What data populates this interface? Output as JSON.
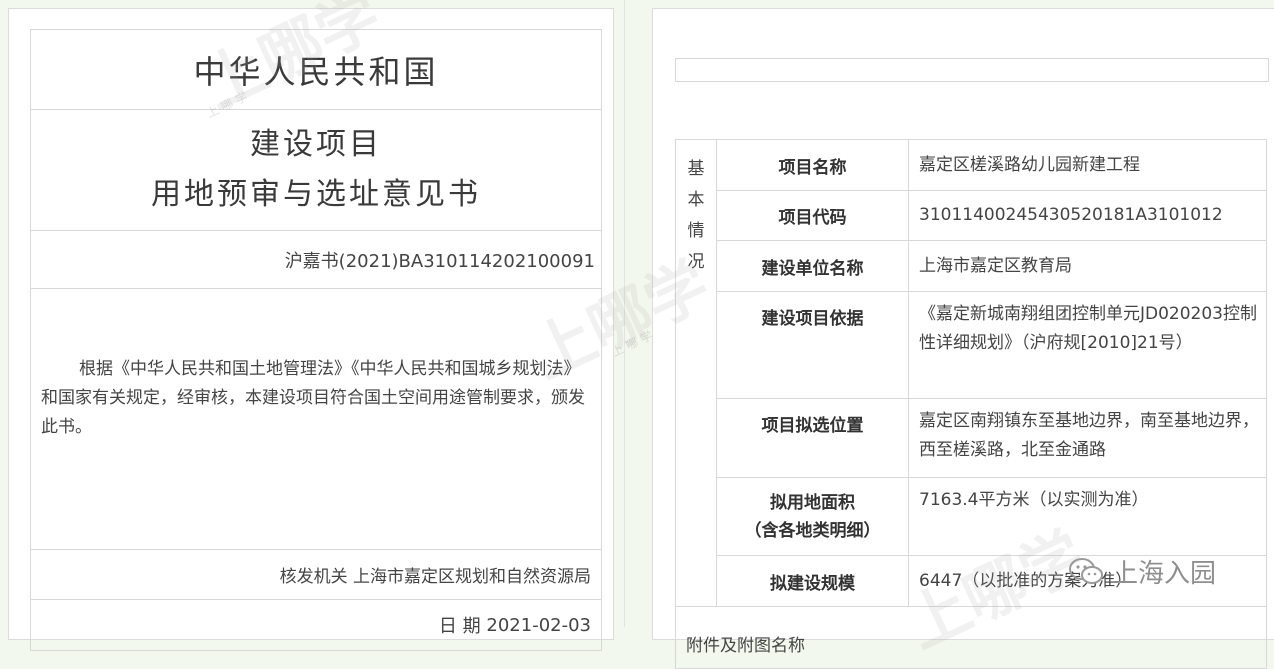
{
  "certificate": {
    "country_title": "中华人民共和国",
    "doc_title_line1": "建设项目",
    "doc_title_line2": "用地预审与选址意见书",
    "doc_number": "沪嘉书(2021)BA310114202100091",
    "body_text": "根据《中华人民共和国土地管理法》《中华人民共和国城乡规划法》和国家有关规定，经审核，本建设项目符合国土空间用途管制要求，颁发此书。",
    "issuer_label": "核发机关",
    "issuer_value": "上海市嘉定区规划和自然资源局",
    "date_label": "日 期",
    "date_value": "2021-02-03"
  },
  "info": {
    "section_label": "基本情况",
    "rows": [
      {
        "label": "项目名称",
        "value": "嘉定区槎溪路幼儿园新建工程"
      },
      {
        "label": "项目代码",
        "value": "3101140024543052018​1A3101012"
      },
      {
        "label": "建设单位名称",
        "value": "上海市嘉定区教育局"
      },
      {
        "label": "建设项目依据",
        "value": "《嘉定新城南翔组团控制单元JD020203控制性详细规划》（沪府规[2010]21号）"
      },
      {
        "label": "项目拟选位置",
        "value": "嘉定区南翔镇东至基地边界，南至基地边界，西至槎溪路，北至金通路"
      },
      {
        "label": "拟用地面积（含各地类明细）",
        "label_line1": "拟用地面积",
        "label_line2": "（含各地类明细）",
        "value": "7163.4平方米（以实测为准）"
      },
      {
        "label": "拟建设规模",
        "value": "6447（以批准的方案为准）"
      }
    ],
    "footer_label": "附件及附图名称"
  },
  "watermark": {
    "text": "上哪学",
    "sub_text": "上 哪 学"
  },
  "badge": {
    "text": "上海入园",
    "icon": "wechat-icon"
  },
  "colors": {
    "background": "#f3f8ee",
    "border": "#d8d8d8",
    "text": "#444444"
  }
}
